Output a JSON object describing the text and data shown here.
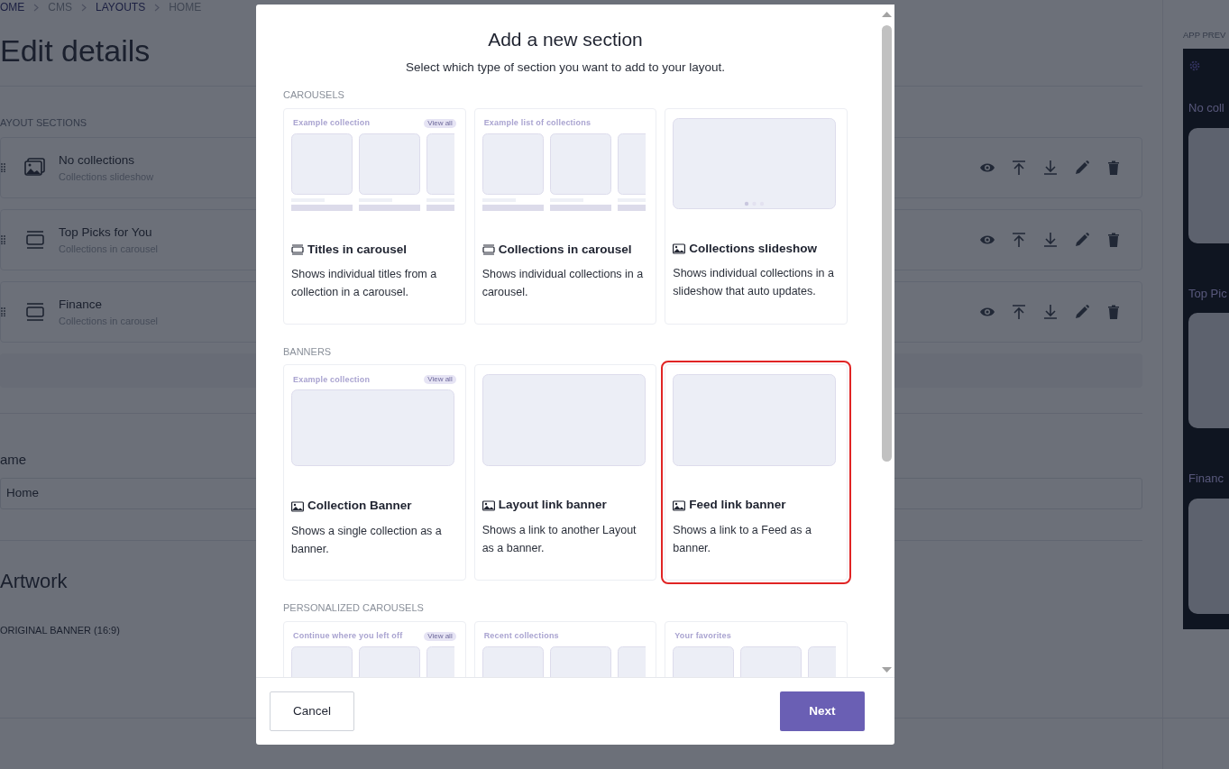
{
  "breadcrumb": [
    {
      "label": "OME",
      "kind": "link"
    },
    {
      "label": "CMS",
      "kind": "text"
    },
    {
      "label": "LAYOUTS",
      "kind": "link"
    },
    {
      "label": "HOME",
      "kind": "text"
    }
  ],
  "page_title": "Edit details",
  "sections_heading": "AYOUT SECTIONS",
  "sections": [
    {
      "kind": "slideshow",
      "title": "No collections",
      "subtitle": "Collections slideshow"
    },
    {
      "kind": "carousel",
      "title": "Top Picks for You",
      "subtitle": "Collections in carousel"
    },
    {
      "kind": "carousel",
      "title": "Finance",
      "subtitle": "Collections in carousel"
    }
  ],
  "name_field": {
    "label": "ame",
    "value": "Home"
  },
  "artwork": {
    "heading": "Artwork",
    "item": "ORIGINAL BANNER (16:9)"
  },
  "app_preview": {
    "heading": "APP PREV",
    "sections": [
      "No coll",
      "Top Pic",
      "Financ"
    ]
  },
  "modal": {
    "title": "Add a new section",
    "subtitle": "Select which type of section you want to add to your layout.",
    "groups": [
      {
        "heading": "CAROUSELS",
        "cards": [
          {
            "kind": "carousel",
            "title": "Titles in carousel",
            "description": "Shows individual titles from a collection in a carousel.",
            "selected": false,
            "preview": {
              "kind": "tiles",
              "caption": "Example collection",
              "badge": "View all"
            }
          },
          {
            "kind": "carousel",
            "title": "Collections in carousel",
            "description": "Shows individual collections in a carousel.",
            "selected": false,
            "preview": {
              "kind": "tiles",
              "caption": "Example list of collections"
            }
          },
          {
            "kind": "image",
            "title": "Collections slideshow",
            "description": "Shows individual collections in a slideshow that auto updates.",
            "selected": false,
            "preview": {
              "kind": "slide"
            }
          }
        ]
      },
      {
        "heading": "BANNERS",
        "cards": [
          {
            "kind": "image",
            "title": "Collection Banner",
            "description": "Shows a single collection as a banner.",
            "selected": false,
            "preview": {
              "kind": "banner",
              "caption": "Example collection",
              "badge": "View all"
            }
          },
          {
            "kind": "image",
            "title": "Layout link banner",
            "description": "Shows a link to another Layout as a banner.",
            "selected": false,
            "preview": {
              "kind": "banner"
            }
          },
          {
            "kind": "image",
            "title": "Feed link banner",
            "description": "Shows a link to a Feed as a banner.",
            "selected": true,
            "preview": {
              "kind": "banner"
            }
          }
        ]
      },
      {
        "heading": "PERSONALIZED CAROUSELS",
        "cards": [
          {
            "selected": false,
            "preview": {
              "kind": "tiles",
              "caption": "Continue where you left off",
              "badge": "View all"
            }
          },
          {
            "selected": false,
            "preview": {
              "kind": "tiles",
              "caption": "Recent collections"
            }
          },
          {
            "selected": false,
            "preview": {
              "kind": "tiles",
              "caption": "Your favorites"
            }
          }
        ]
      }
    ],
    "cancel_button": "Cancel",
    "next_button": "Next"
  }
}
